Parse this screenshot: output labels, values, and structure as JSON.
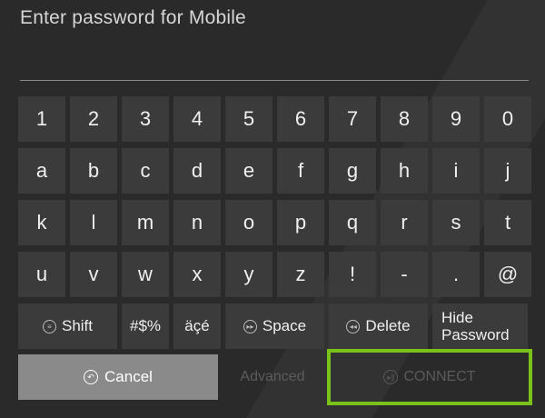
{
  "prompt": "Enter password for Mobile",
  "password": {
    "value": ""
  },
  "keyboard": {
    "rows": [
      [
        "1",
        "2",
        "3",
        "4",
        "5",
        "6",
        "7",
        "8",
        "9",
        "0"
      ],
      [
        "a",
        "b",
        "c",
        "d",
        "e",
        "f",
        "g",
        "h",
        "i",
        "j"
      ],
      [
        "k",
        "l",
        "m",
        "n",
        "o",
        "p",
        "q",
        "r",
        "s",
        "t"
      ],
      [
        "u",
        "v",
        "w",
        "x",
        "y",
        "z",
        "!",
        "-",
        ".",
        "@"
      ]
    ],
    "shift_label": "Shift",
    "symbols_label": "#$%",
    "accents_label": "äçé",
    "space_label": "Space",
    "delete_label": "Delete",
    "hide_password_line1": "Hide",
    "hide_password_line2": "Password"
  },
  "actions": {
    "cancel_label": "Cancel",
    "advanced_label": "Advanced",
    "connect_label": "CONNECT"
  },
  "colors": {
    "background": "#2a2a2a",
    "key": "#3b3b3b",
    "cancel_button": "#8a8a8a",
    "focus_highlight": "#7ac21a"
  },
  "icons": {
    "shift": "menu-icon",
    "space": "fast-forward-icon",
    "delete": "rewind-icon",
    "cancel": "back-icon",
    "connect": "play-pause-icon"
  }
}
